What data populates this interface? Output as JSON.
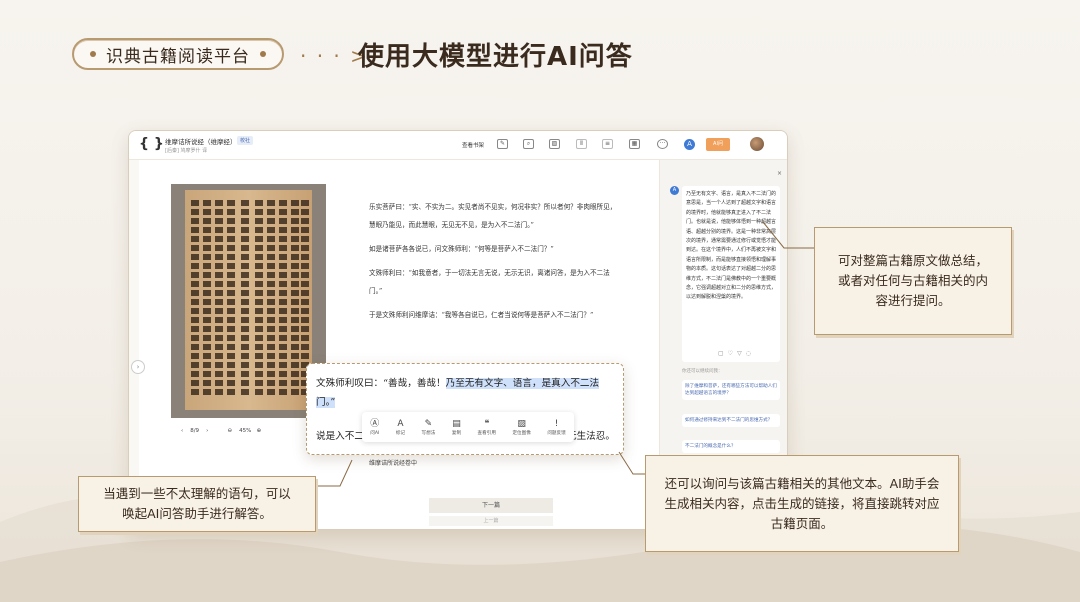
{
  "header": {
    "pill_label": "识典古籍阅读平台",
    "arrow": "· · · >",
    "headline": "使用大模型进行AI问答"
  },
  "app": {
    "book_title": "维摩诘所说经（维摩经）",
    "book_tag": "校社",
    "book_subtitle": "[后秦] 鸠摩罗什 译",
    "view_label": "查看书架",
    "toolbar_orange": "AI问",
    "pager": {
      "prev": "‹",
      "page": "8/9",
      "next": "›",
      "zoom": "45%"
    },
    "text_paragraphs": [
      "乐实菩萨曰：“实、不实为二。实见者尚不见实，何况非实？所以者何？非肉眼所见，慧眼乃能见，而此慧眼，无见无不见，是为入不二法门。”",
      "如是诸菩萨各各说已，问文殊师利：“何等是菩萨入不二法门？”",
      "文殊师利曰：“如我意者，于一切法无言无说，无示无识，离诸问答，是为入不二法门。”",
      "于是文殊师利问维摩诘：“我等各自说已，仁者当说何等是菩萨入不二法门？”"
    ],
    "below_text": "维摩诘所说经卷中",
    "next_button": "下一篇",
    "next_button2": "上一篇",
    "popup": {
      "line1_plain": "文殊师利叹曰：“善哉，善哉！",
      "line1_highlight": "乃至无有文字、语言，是真入不二法门。”",
      "line3_left": "说是入不二",
      "line3_right": "无生法忍。"
    },
    "tools": [
      {
        "icon": "Ⓐ",
        "label": "问AI",
        "name": "ask-ai-tool"
      },
      {
        "icon": "A",
        "label": "标记",
        "name": "mark-tool"
      },
      {
        "icon": "✎",
        "label": "写想法",
        "name": "note-tool"
      },
      {
        "icon": "▤",
        "label": "复制",
        "name": "copy-tool"
      },
      {
        "icon": "❝",
        "label": "查看引用",
        "name": "quote-tool"
      },
      {
        "icon": "▨",
        "label": "定位图像",
        "name": "locate-image-tool"
      },
      {
        "icon": "!",
        "label": "问题反馈",
        "name": "feedback-tool"
      }
    ],
    "right_panel": {
      "close": "×",
      "answer": "乃至无有文字、语言，是真入不二法门的意思是，当一个人达到了超越文字和语言的境界时，他就能够真正进入了不二法门。也就是说，他能够体悟到一种超越言语、超越分别的境界。这是一种非常高层次的境界，通常需要通过修行或觉悟才能到达。在这个境界中，人们不再被文字和语言所限制，而是能够直接领悟和理解事物的本质。这句话表达了对超越二分的思维方式，不二法门是佛教中的一个重要概念，它强调超越对立和二分的思维方式，以达到解脱和涅槃的境界。",
      "hint": "你还可以继续问我：",
      "suggestions": [
        "除了维摩和菩萨，还有哪些方法可以帮助人们达到超越语言的境界？",
        "如何通过修持来达到不二法门的思维方式？",
        "不二法门的概念是什么？"
      ]
    }
  },
  "callouts": {
    "c1": "可对整篇古籍原文做总结，或者对任何与古籍相关的内容进行提问。",
    "c2": "当遇到一些不太理解的语句，可以唤起AI问答助手进行解答。",
    "c3": "还可以询问与该篇古籍相关的其他文本。AI助手会生成相关内容，点击生成的链接，将直接跳转对应古籍页面。"
  },
  "colors": {
    "accent": "#b89a71",
    "ai_blue": "#3f7ad6",
    "orange": "#f0a05a",
    "highlight": "#cfe0fb"
  }
}
